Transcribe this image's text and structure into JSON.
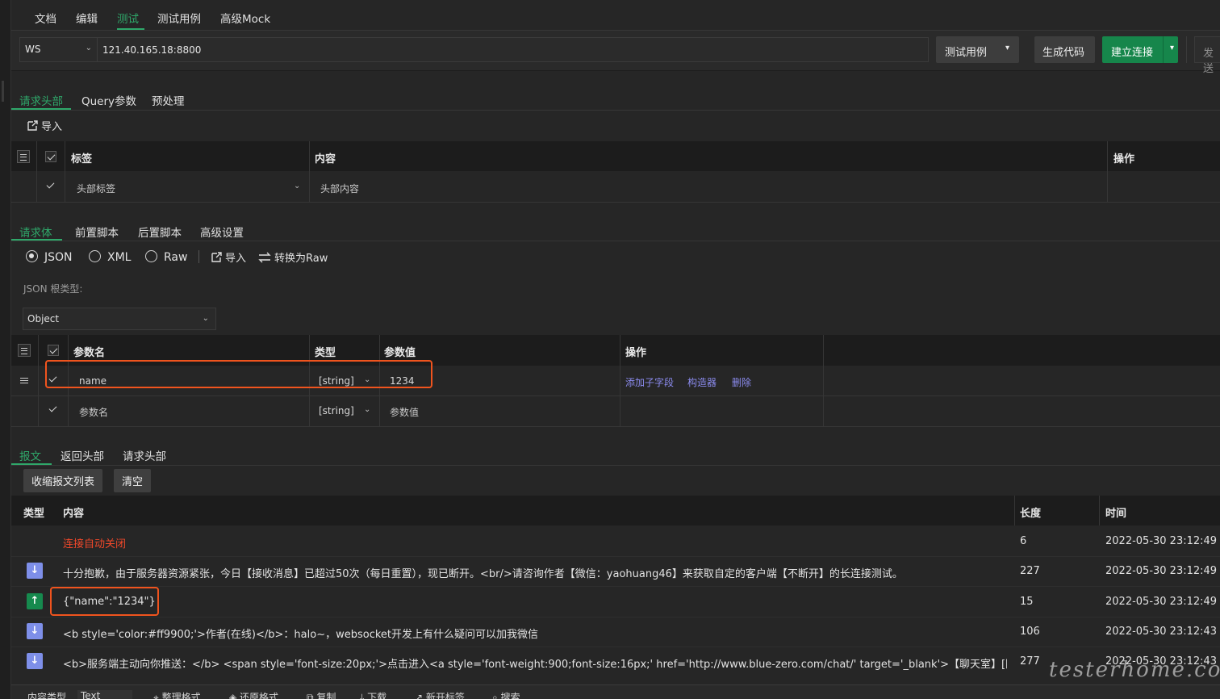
{
  "top_tabs": [
    "文档",
    "编辑",
    "测试",
    "测试用例",
    "高级Mock"
  ],
  "url_bar": {
    "protocol": "WS",
    "url": "121.40.165.18:8800",
    "testcase_button": "测试用例",
    "gen_code_button": "生成代码",
    "connect_button": "建立连接",
    "send_button": "发送"
  },
  "request_tabs": [
    "请求头部",
    "Query参数",
    "预处理"
  ],
  "import_label": "导入",
  "headers_table": {
    "col_label": "标签",
    "col_content": "内容",
    "col_action": "操作",
    "row_label_placeholder": "头部标签",
    "row_content_placeholder": "头部内容"
  },
  "body_tabs": [
    "请求体",
    "前置脚本",
    "后置脚本",
    "高级设置"
  ],
  "body_formats": [
    "JSON",
    "XML",
    "Raw"
  ],
  "body_actions": {
    "import": "导入",
    "convert": "转换为Raw"
  },
  "json_root_label": "JSON 根类型:",
  "json_root_value": "Object",
  "params_table": {
    "col_name": "参数名",
    "col_type": "类型",
    "col_value": "参数值",
    "col_action": "操作",
    "rows": [
      {
        "name": "name",
        "type": "[string]",
        "value": "1234",
        "actions": [
          "添加子字段",
          "构造器",
          "删除"
        ]
      },
      {
        "name": "参数名",
        "type": "[string]",
        "value": "参数值"
      }
    ]
  },
  "response_tabs": [
    "报文",
    "返回头部",
    "请求头部"
  ],
  "response_buttons": {
    "collapse": "收缩报文列表",
    "clear": "清空"
  },
  "messages_table": {
    "col_type": "类型",
    "col_content": "内容",
    "col_length": "长度",
    "col_time": "时间",
    "rows": [
      {
        "dir": "none",
        "content": "连接自动关闭",
        "length": "6",
        "time": "2022-05-30 23:12:49",
        "red": true
      },
      {
        "dir": "in",
        "content": "十分抱歉，由于服务器资源紧张，今日【接收消息】已超过50次（每日重置），现已断开。<br/>请咨询作者【微信：yaohuang46】来获取自定的客户端【不断开】的长连接测试。",
        "length": "227",
        "time": "2022-05-30 23:12:49"
      },
      {
        "dir": "out",
        "content": "{\"name\":\"1234\"}",
        "length": "15",
        "time": "2022-05-30 23:12:49"
      },
      {
        "dir": "in",
        "content": "<b style='color:#ff9900;'>作者(在线)</b>：halo~，websocket开发上有什么疑问可以加我微信",
        "length": "106",
        "time": "2022-05-30 23:12:43"
      },
      {
        "dir": "in",
        "content": "<b>服务端主动向你推送：</b> <span style='font-size:20px;'>点击进入<a style='font-weight:900;font-size:16px;' href='http://www.blue-zero.com/chat/' target='_blank'>【聊天室】[围观]</a>，…",
        "length": "277",
        "time": "2022-05-30 23:12:43"
      }
    ]
  },
  "bottom_bar": {
    "content_type_label": "内容类型",
    "content_type_value": "Text",
    "format": "整理格式",
    "restore": "还原格式",
    "copy": "复制",
    "download": "下载",
    "new_tab": "新开标签",
    "search": "搜索"
  },
  "watermark": "testerhome.com",
  "colors": {
    "accent_green": "#2fa86a",
    "button_green": "#16864b",
    "highlight_orange": "#f0541e",
    "link_purple": "#8c8cf0",
    "error_red": "#f0482a"
  }
}
